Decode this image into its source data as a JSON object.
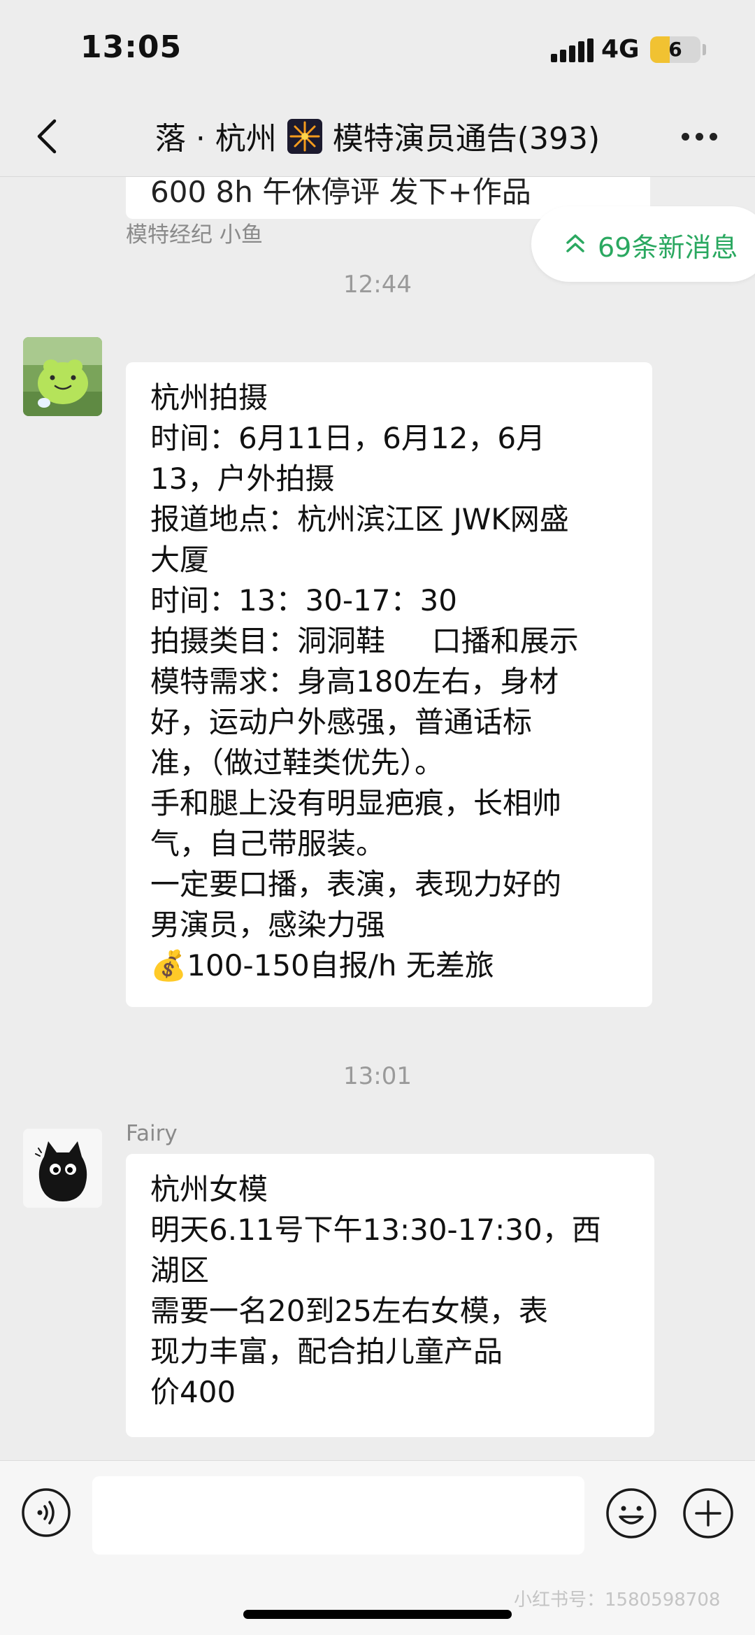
{
  "status_bar": {
    "time": "13:05",
    "network": "4G",
    "battery": "6"
  },
  "nav": {
    "title_prefix": "落 · 杭州",
    "title_suffix": "模特演员通告(393)"
  },
  "new_messages": "69条新消息",
  "truncated_message": "600 8h 午休停评 发下+作品",
  "messages": [
    {
      "time": "12:44",
      "sender": "模特经纪 小鱼",
      "text": "杭州拍摄\n时间：6月11日，6月12，6月\n13，户外拍摄\n报道地点：杭州滨江区 JWK网盛\n大厦\n时间：13：30-17：30\n拍摄类目：洞洞鞋     口播和展示\n模特需求：身高180左右，身材\n好，运动户外感强，普通话标\n准，（做过鞋类优先）。\n手和腿上没有明显疤痕，长相帅\n气，自己带服装。\n一定要口播，表演，表现力好的\n男演员，感染力强\n💰100-150自报/h 无差旅"
    },
    {
      "time": "13:01",
      "sender": "Fairy",
      "text": "杭州女模\n明天6.11号下午13:30-17:30，西\n湖区\n需要一名20到25左右女模，表\n现力丰富，配合拍儿童产品\n价400"
    }
  ],
  "watermark": "小红书号：1580598708"
}
